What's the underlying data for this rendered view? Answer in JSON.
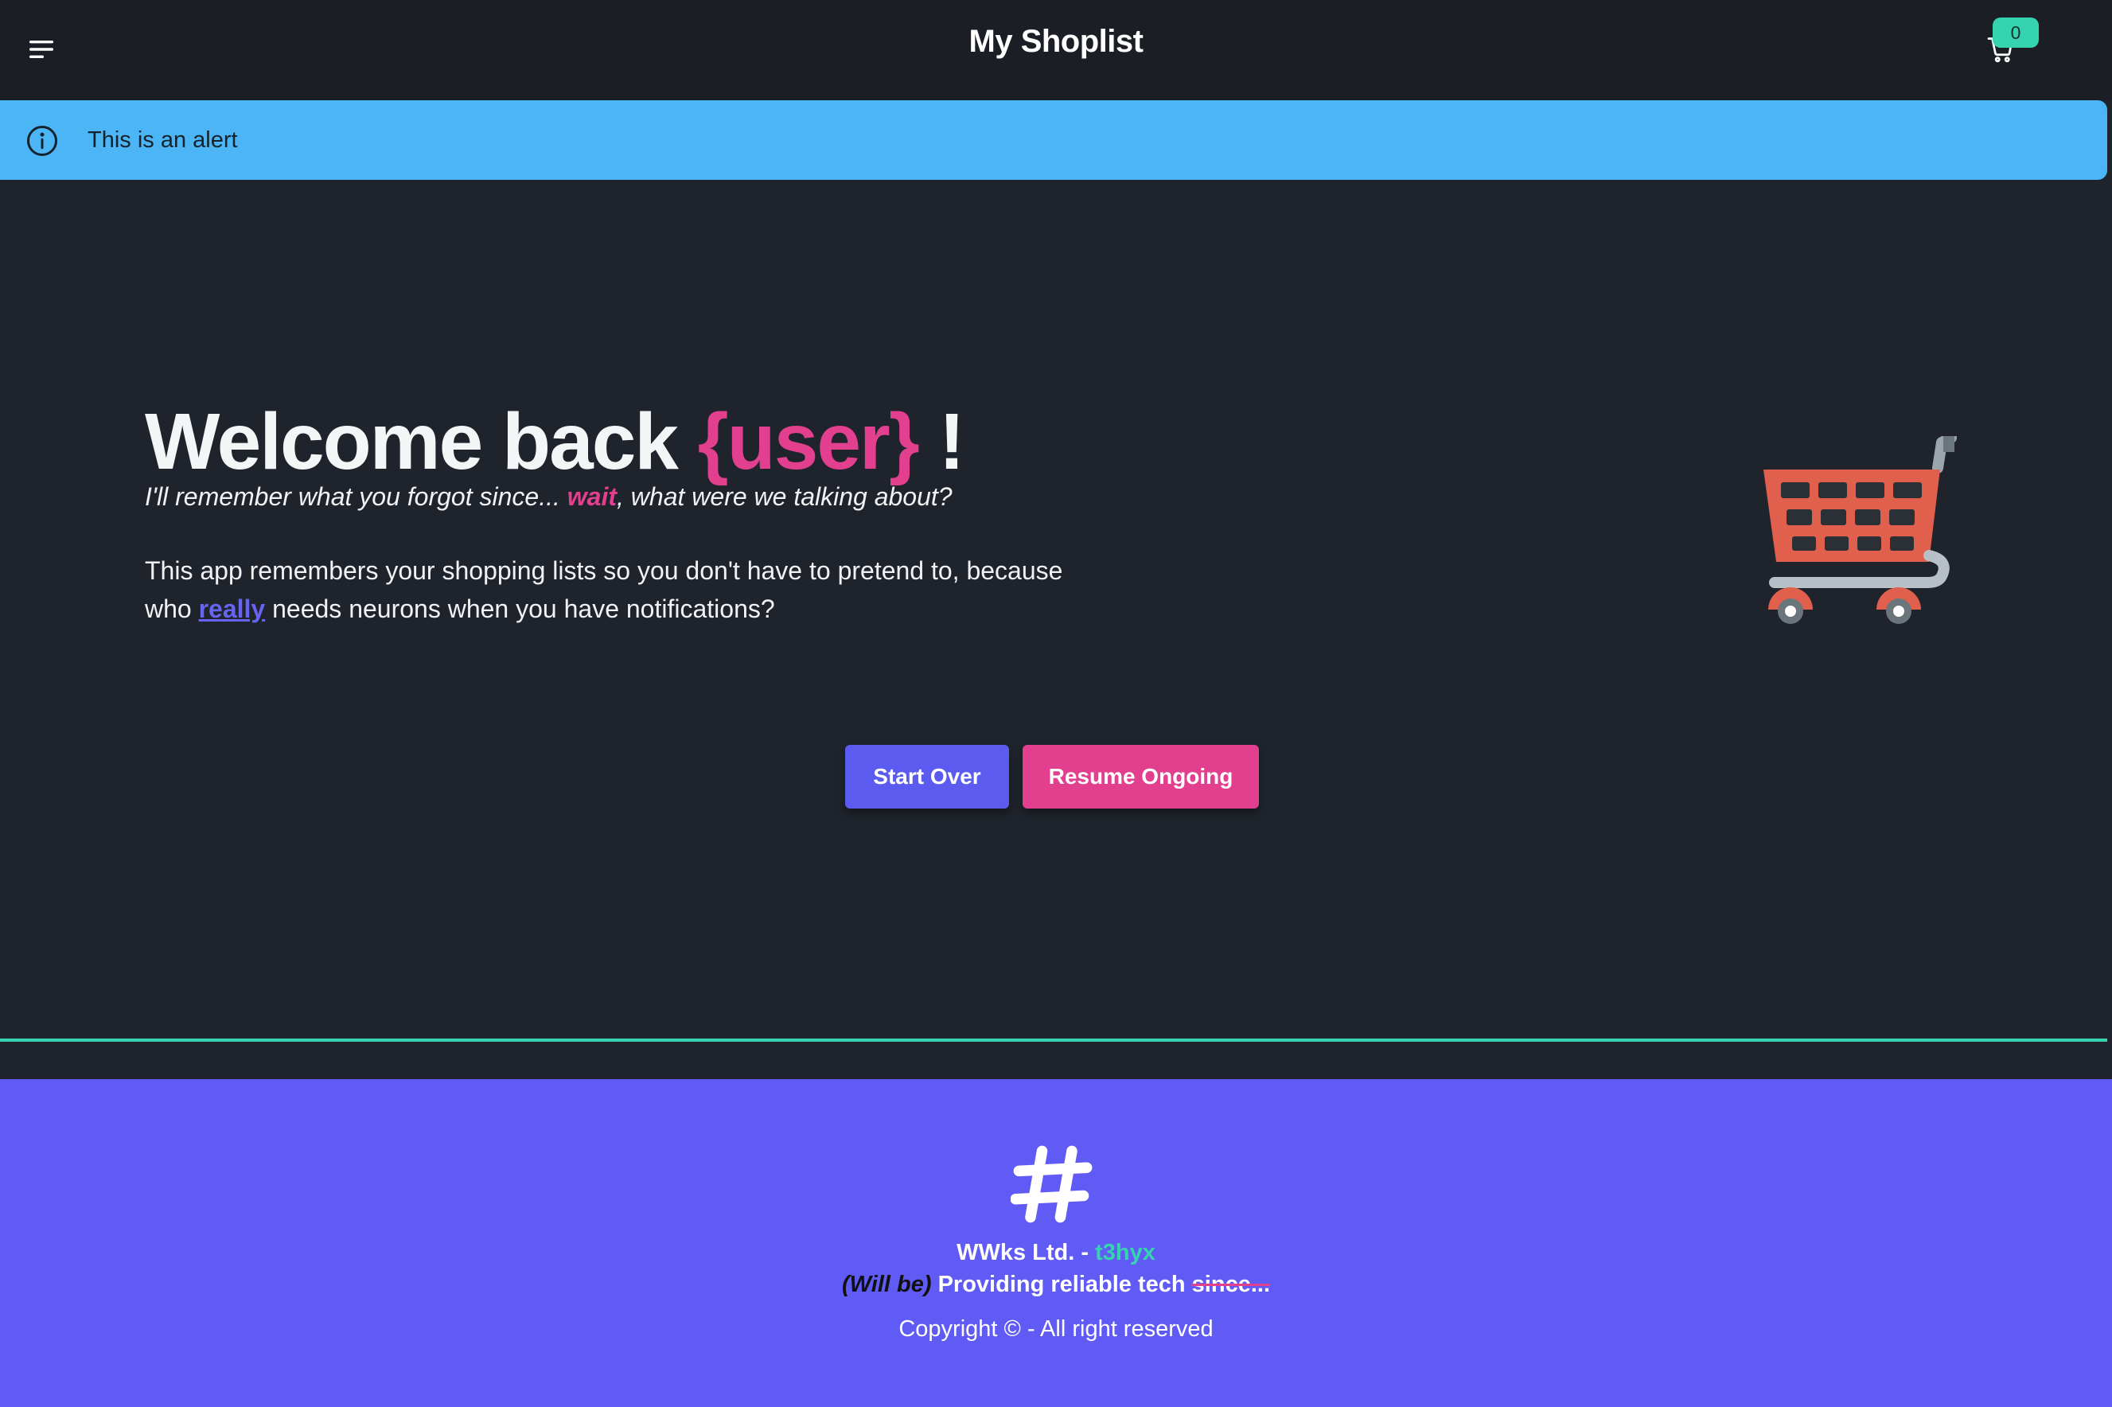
{
  "navbar": {
    "title": "My Shoplist",
    "menu_icon": "menu-icon",
    "cart_icon": "shopping-cart-icon",
    "cart_count": "0"
  },
  "alert": {
    "icon": "info-icon",
    "text": "This is an alert",
    "color": "#4cb5f6"
  },
  "hero": {
    "title_prefix": "Welcome back ",
    "title_user": "{user}",
    "title_suffix": " !",
    "subtitle_part1": "I'll remember what you forgot since... ",
    "subtitle_highlight": "wait",
    "subtitle_part2": ", what were we talking about?",
    "desc_part1": "This app remembers your shopping lists so you don't have to pretend to, because who ",
    "desc_link": "really",
    "desc_part2": " needs neurons when you have notifications?",
    "illustration": "shopping-cart-illustration",
    "buttons": {
      "start_over": "Start Over",
      "resume": "Resume Ongoing"
    }
  },
  "footer": {
    "logo_icon": "hash-icon",
    "company": "WWks Ltd. - ",
    "handle": "t3hyx",
    "tagline_italic": "(Will be)",
    "tagline_main": " Providing reliable tech ",
    "tagline_strike": "since...",
    "copyright": "Copyright © - All right reserved"
  },
  "colors": {
    "background": "#1f232b",
    "navbar": "#1b1e25",
    "accent_pink": "#e2408f",
    "accent_indigo": "#5b5cef",
    "accent_teal": "#36d3b0",
    "footer": "#615bf5"
  }
}
